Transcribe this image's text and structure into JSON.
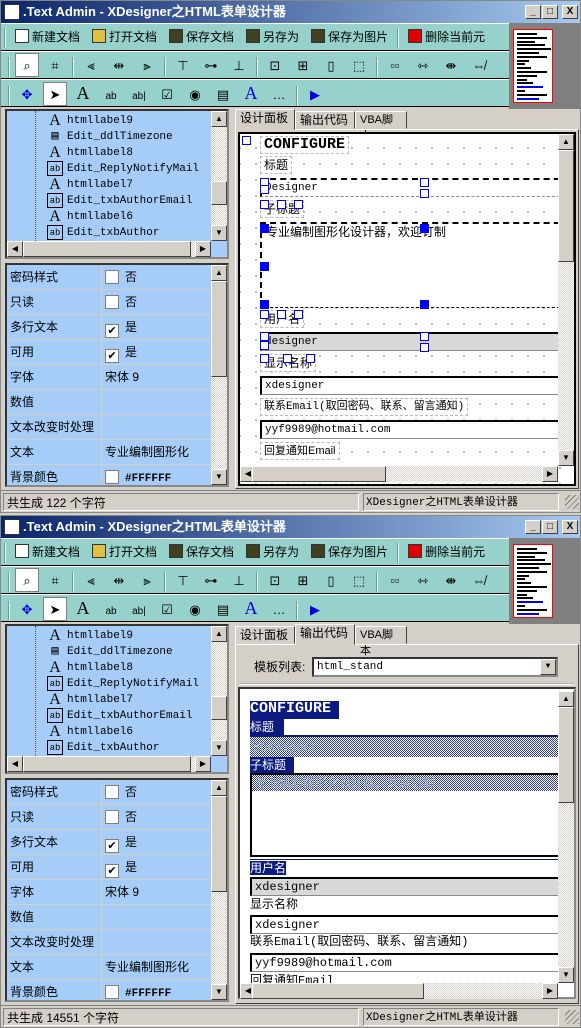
{
  "app_title": ".Text Admin - XDesigner之HTML表单设计器",
  "window_buttons": {
    "minimize": "_",
    "maximize": "□",
    "close": "X"
  },
  "toolbar": {
    "file_buttons": [
      {
        "label": "新建文档",
        "icon": "new-doc-icon",
        "color": "#ffffff"
      },
      {
        "label": "打开文档",
        "icon": "open-folder-icon",
        "color": "#e0c040"
      },
      {
        "label": "保存文档",
        "icon": "save-disk-icon",
        "color": "#404020"
      },
      {
        "label": "另存为",
        "icon": "save-disk-icon",
        "color": "#404020"
      },
      {
        "label": "保存为图片",
        "icon": "save-disk-icon",
        "color": "#404020"
      },
      {
        "label": "删除当前元",
        "icon": "delete-x-icon",
        "color": "#e00000"
      }
    ],
    "layout_icons": [
      {
        "name": "zoom-icon",
        "glyph": "⌕",
        "selected": true
      },
      {
        "name": "grid-snap-icon",
        "glyph": "⌗"
      },
      {
        "sep": true
      },
      {
        "name": "align-left-icon",
        "glyph": "⫷"
      },
      {
        "name": "align-center-icon",
        "glyph": "⇹"
      },
      {
        "name": "align-right-icon",
        "glyph": "⫸"
      },
      {
        "sep": true
      },
      {
        "name": "align-top-icon",
        "glyph": "⊤"
      },
      {
        "name": "align-middle-icon",
        "glyph": "⊶"
      },
      {
        "name": "align-bottom-icon",
        "glyph": "⊥"
      },
      {
        "sep": true
      },
      {
        "name": "center-horizontal-icon",
        "glyph": "⊡"
      },
      {
        "name": "center-both-icon",
        "glyph": "⊞"
      },
      {
        "name": "same-height-icon",
        "glyph": "▯"
      },
      {
        "name": "same-size-icon",
        "glyph": "⬚"
      },
      {
        "sep": true
      },
      {
        "name": "space-horizontal-icon",
        "glyph": "▫▫"
      },
      {
        "name": "increase-spacing-icon",
        "glyph": "⇿"
      },
      {
        "name": "decrease-spacing-icon",
        "glyph": "⇼"
      },
      {
        "name": "remove-spacing-icon",
        "glyph": "⇎"
      }
    ],
    "tool_icons": [
      {
        "name": "move-icon",
        "glyph": "✥",
        "color": "#0000e0"
      },
      {
        "name": "pointer-icon",
        "glyph": "➤",
        "selected": true,
        "color": "#000000"
      },
      {
        "name": "label-tool-icon",
        "glyph": "A",
        "color": "#000000"
      },
      {
        "name": "textbox-tool-icon",
        "glyph": "ab",
        "color": "#000000"
      },
      {
        "name": "textarea-tool-icon",
        "glyph": "ab|",
        "color": "#000000"
      },
      {
        "name": "checkbox-tool-icon",
        "glyph": "☑",
        "color": "#000000"
      },
      {
        "name": "radio-tool-icon",
        "glyph": "◉",
        "color": "#000000"
      },
      {
        "name": "select-tool-icon",
        "glyph": "▤",
        "color": "#000000"
      },
      {
        "name": "link-tool-icon",
        "glyph": "A",
        "color": "#0000e0"
      },
      {
        "name": "button-tool-icon",
        "glyph": "…",
        "color": "#000000"
      },
      {
        "sep": true
      },
      {
        "name": "run-icon",
        "glyph": "▶",
        "color": "#0000e0"
      }
    ]
  },
  "tree": [
    {
      "label": "htmllabel9",
      "icon": "label-icon"
    },
    {
      "label": "Edit_ddlTimezone",
      "icon": "select-icon"
    },
    {
      "label": "htmllabel8",
      "icon": "label-icon"
    },
    {
      "label": "Edit_ReplyNotifyMail",
      "icon": "textbox-icon"
    },
    {
      "label": "htmllabel7",
      "icon": "label-icon"
    },
    {
      "label": "Edit_txbAuthorEmail",
      "icon": "textbox-icon"
    },
    {
      "label": "htmllabel6",
      "icon": "label-icon"
    },
    {
      "label": "Edit_txbAuthor",
      "icon": "textbox-icon"
    }
  ],
  "properties": [
    {
      "key": "密码样式",
      "value": "否",
      "checkbox": false
    },
    {
      "key": "只读",
      "value": "否",
      "checkbox": false
    },
    {
      "key": "多行文本",
      "value": "是",
      "checkbox": true
    },
    {
      "key": "可用",
      "value": "是",
      "checkbox": true
    },
    {
      "key": "字体",
      "value": "宋体 9"
    },
    {
      "key": "数值",
      "value": ""
    },
    {
      "key": "文本改变时处理",
      "value": ""
    },
    {
      "key": "文本",
      "value": "专业编制图形化"
    },
    {
      "key": "背景颜色",
      "value": "#FFFFFF",
      "swatch": "#FFFFFF"
    }
  ],
  "tabs": [
    "设计面板",
    "输出代码",
    "VBA脚本"
  ],
  "form": {
    "heading": "CONFIGURE",
    "title_label": "标题",
    "title_value": "Designer",
    "title_value_output": "XDesigner",
    "subtitle_label": "子标题",
    "subtitle_text": "专业编制图形化设计器，欢迎订制",
    "username_label": "用户名",
    "username_value": "designer",
    "username_value_output": "xdesigner",
    "display_name_label": "显示名称",
    "display_name_value": "xdesigner",
    "email_label": "联系Email(取回密码、联系、留言通知)",
    "email_value": "yyf9989@hotmail.com",
    "reply_label": "回复通知Email"
  },
  "template_list": {
    "label": "模板列表:",
    "value": "html_stand"
  },
  "windows": [
    {
      "active_tab": 0,
      "status_left": "共生成 122 个字符",
      "status_right": "XDesigner之HTML表单设计器"
    },
    {
      "active_tab": 1,
      "status_left": "共生成 14551 个字符",
      "status_right": "XDesigner之HTML表单设计器"
    }
  ],
  "colors": {
    "title_start": "#0a246a",
    "title_end": "#a6caf0",
    "toolbar": "#96d2cb",
    "panel": "#a6cdf8",
    "highlight": "#0a1a80",
    "handle": "#0000ff"
  }
}
